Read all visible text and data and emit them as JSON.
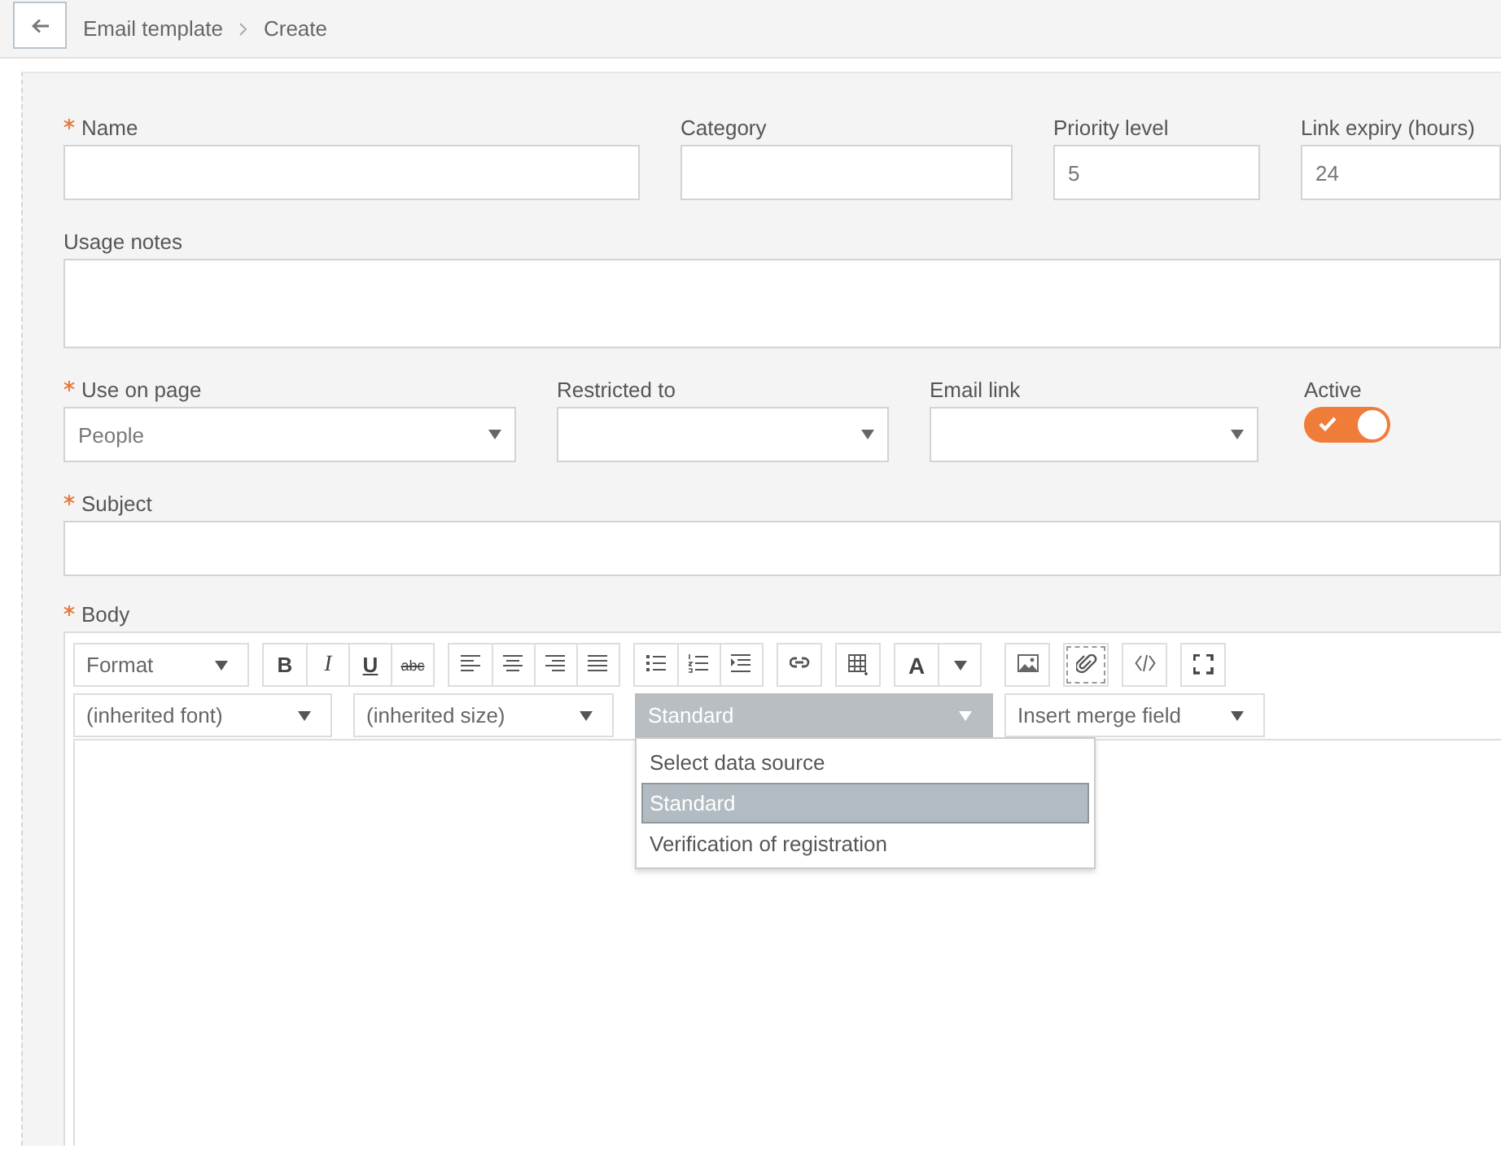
{
  "header": {
    "breadcrumb": [
      "Email template",
      "Create"
    ]
  },
  "rows": [
    [
      {
        "kind": "text",
        "label": "Name",
        "required": true
      },
      {
        "kind": "text",
        "label": "Category",
        "required": false
      },
      {
        "kind": "text",
        "label": "Priority level",
        "required": false,
        "value": "5"
      },
      {
        "kind": "text",
        "label": "Link expiry (hours)",
        "required": false,
        "value": "24"
      }
    ],
    [
      {
        "kind": "textarea",
        "label": "Usage notes",
        "required": false
      }
    ],
    [
      {
        "kind": "select",
        "label": "Use on page",
        "required": true,
        "value": "People"
      },
      {
        "kind": "select",
        "label": "Restricted to",
        "required": false
      },
      {
        "kind": "select",
        "label": "Email link",
        "required": false
      },
      {
        "kind": "toggle",
        "label": "Active",
        "required": false,
        "on": true
      }
    ],
    [
      {
        "kind": "text",
        "label": "Subject",
        "required": true
      }
    ]
  ],
  "editor": {
    "label": "Body",
    "required": true,
    "toolbar_row1": [
      {
        "kind": "dropdown",
        "label": "Format"
      },
      {
        "kind": "group",
        "buttons": [
          {
            "kind": "text",
            "text": "B",
            "focused": false
          },
          {
            "kind": "text",
            "text": "I",
            "focused": false
          },
          {
            "kind": "text",
            "text": "U",
            "focused": false
          },
          {
            "kind": "text",
            "text": "abc",
            "focused": false
          }
        ]
      },
      {
        "kind": "group",
        "buttons": [
          {
            "kind": "icon",
            "focused": false
          },
          {
            "kind": "icon",
            "focused": false
          },
          {
            "kind": "icon",
            "focused": false
          },
          {
            "kind": "icon",
            "focused": false
          }
        ]
      },
      {
        "kind": "group",
        "buttons": [
          {
            "kind": "icon",
            "focused": false
          },
          {
            "kind": "icon",
            "focused": false
          },
          {
            "kind": "icon",
            "focused": false
          }
        ]
      },
      {
        "kind": "group",
        "buttons": [
          {
            "kind": "icon",
            "focused": false
          }
        ]
      },
      {
        "kind": "group",
        "buttons": [
          {
            "kind": "icon",
            "focused": false
          }
        ]
      },
      {
        "kind": "group",
        "buttons": [
          {
            "kind": "text",
            "text": "A",
            "focused": false
          },
          {
            "kind": "icon",
            "focused": false
          }
        ]
      },
      {
        "kind": "group",
        "buttons": [
          {
            "kind": "icon",
            "focused": false
          }
        ]
      },
      {
        "kind": "group",
        "buttons": [
          {
            "kind": "icon",
            "focused": true
          }
        ]
      },
      {
        "kind": "group",
        "buttons": [
          {
            "kind": "icon",
            "focused": false
          }
        ]
      },
      {
        "kind": "group",
        "buttons": [
          {
            "kind": "icon",
            "focused": false
          }
        ]
      }
    ],
    "toolbar_row2": [
      {
        "label": "(inherited font)",
        "open": false
      },
      {
        "label": "(inherited size)",
        "open": false
      },
      {
        "label": "Standard",
        "open": true,
        "options": [
          {
            "label": "Select data source",
            "selected": false
          },
          {
            "label": "Standard",
            "selected": true
          },
          {
            "label": "Verification of registration",
            "selected": false
          }
        ]
      },
      {
        "label": "Insert merge field",
        "open": false
      }
    ]
  }
}
